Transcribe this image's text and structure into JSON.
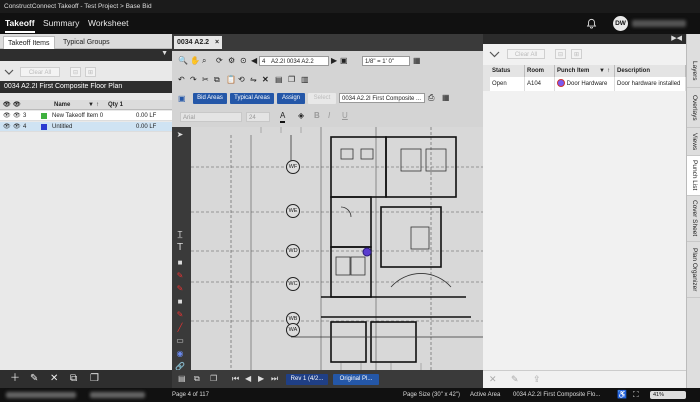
{
  "window_title": "ConstructConnect Takeoff - Test Project > Base Bid",
  "nav": {
    "takeoff": "Takeoff",
    "summary": "Summary",
    "worksheet": "Worksheet"
  },
  "user": {
    "initials": "DW"
  },
  "left_panel": {
    "tabs": [
      "Takeoff Items",
      "Typical Groups"
    ],
    "clear_all": "Clear All",
    "plan_name": "0034 A2.2I First Composite Floor Plan",
    "columns": {
      "name": "Name",
      "qty": "Qty 1"
    },
    "rows": [
      {
        "num": "3",
        "name": "New Takeoff Item 0",
        "qty": "0.00 LF",
        "color": "#3fb13f"
      },
      {
        "num": "4",
        "name": "Untitled",
        "qty": "0.00 LF",
        "color": "#2b3bd1"
      }
    ]
  },
  "center": {
    "doc_tab": "0034 A2.2",
    "page_num": "4",
    "page_select": "A2.2I 0034 A2.2",
    "scale": "1/8\" = 1' 0\"",
    "buttons": {
      "bid_areas": "Bid Areas",
      "typical_areas": "Typical Areas",
      "assign": "Assign",
      "select": "Select"
    },
    "plan_select": "0034 A2.2I First Composite ...",
    "font": "Arial",
    "font_size": "24",
    "grid_labels": [
      "WF",
      "WE",
      "WD",
      "WC",
      "WB",
      "WA"
    ],
    "rev": "Rev 1 (4/2...",
    "original": "Original Pl..."
  },
  "right_panel": {
    "clear_all": "Clear All",
    "columns": {
      "status": "Status",
      "room": "Room",
      "punch_item": "Punch Item",
      "description": "Description"
    },
    "row": {
      "status": "Open",
      "room": "A104",
      "punch_item": "Door Hardware",
      "description": "Door hardware installed"
    }
  },
  "side_tabs": [
    "Layers",
    "Overlays",
    "Views",
    "Punch List",
    "Cover Sheet",
    "Plan Organizer"
  ],
  "status_bar": {
    "page": "Page 4 of 117",
    "page_size": "Page Size (30\" x 42\")",
    "active_area": "Active Area",
    "plan": "0034 A2.2I First Composite Flo...",
    "zoom": "41%"
  },
  "colors": {
    "accent_blue": "#2457a8",
    "dark_bar": "#2e2e2e",
    "selected_row": "#cfe3f3"
  }
}
